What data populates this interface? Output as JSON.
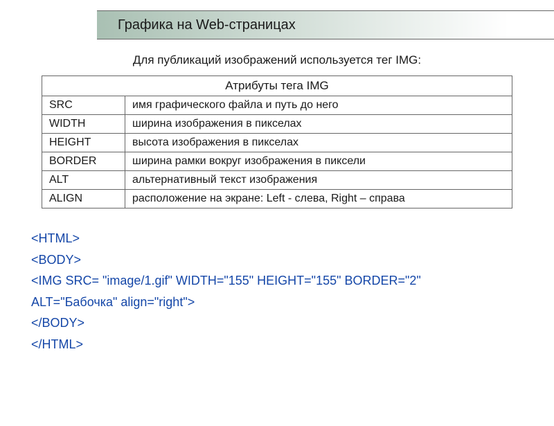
{
  "header": {
    "title": "Графика на Web-страницах"
  },
  "subtitle": "Для публикаций изображений используется тег IMG:",
  "table": {
    "header": "Атрибуты тега IMG",
    "rows": [
      {
        "attr": "SRC",
        "desc": "имя графического файла и путь до него"
      },
      {
        "attr": "WIDTH",
        "desc": "ширина изображения в пикселах"
      },
      {
        "attr": "HEIGHT",
        "desc": "высота изображения в пикселах"
      },
      {
        "attr": "BORDER",
        "desc": "ширина рамки вокруг изображения в пиксели"
      },
      {
        "attr": "ALT",
        "desc": "альтернативный текст изображения"
      },
      {
        "attr": "ALIGN",
        "desc": "расположение на экране: Left - слева, Right – справа"
      }
    ]
  },
  "code": {
    "line1": "<HTML>",
    "line2": "<BODY>",
    "line3": "<IMG SRC= \"image/1.gif\" WIDTH=\"155\" HEIGHT=\"155\" BORDER=\"2\"",
    "line4": "ALT=\"Бабочка\" align=\"right\">",
    "line5": "</BODY>",
    "line6": "</HTML>"
  }
}
